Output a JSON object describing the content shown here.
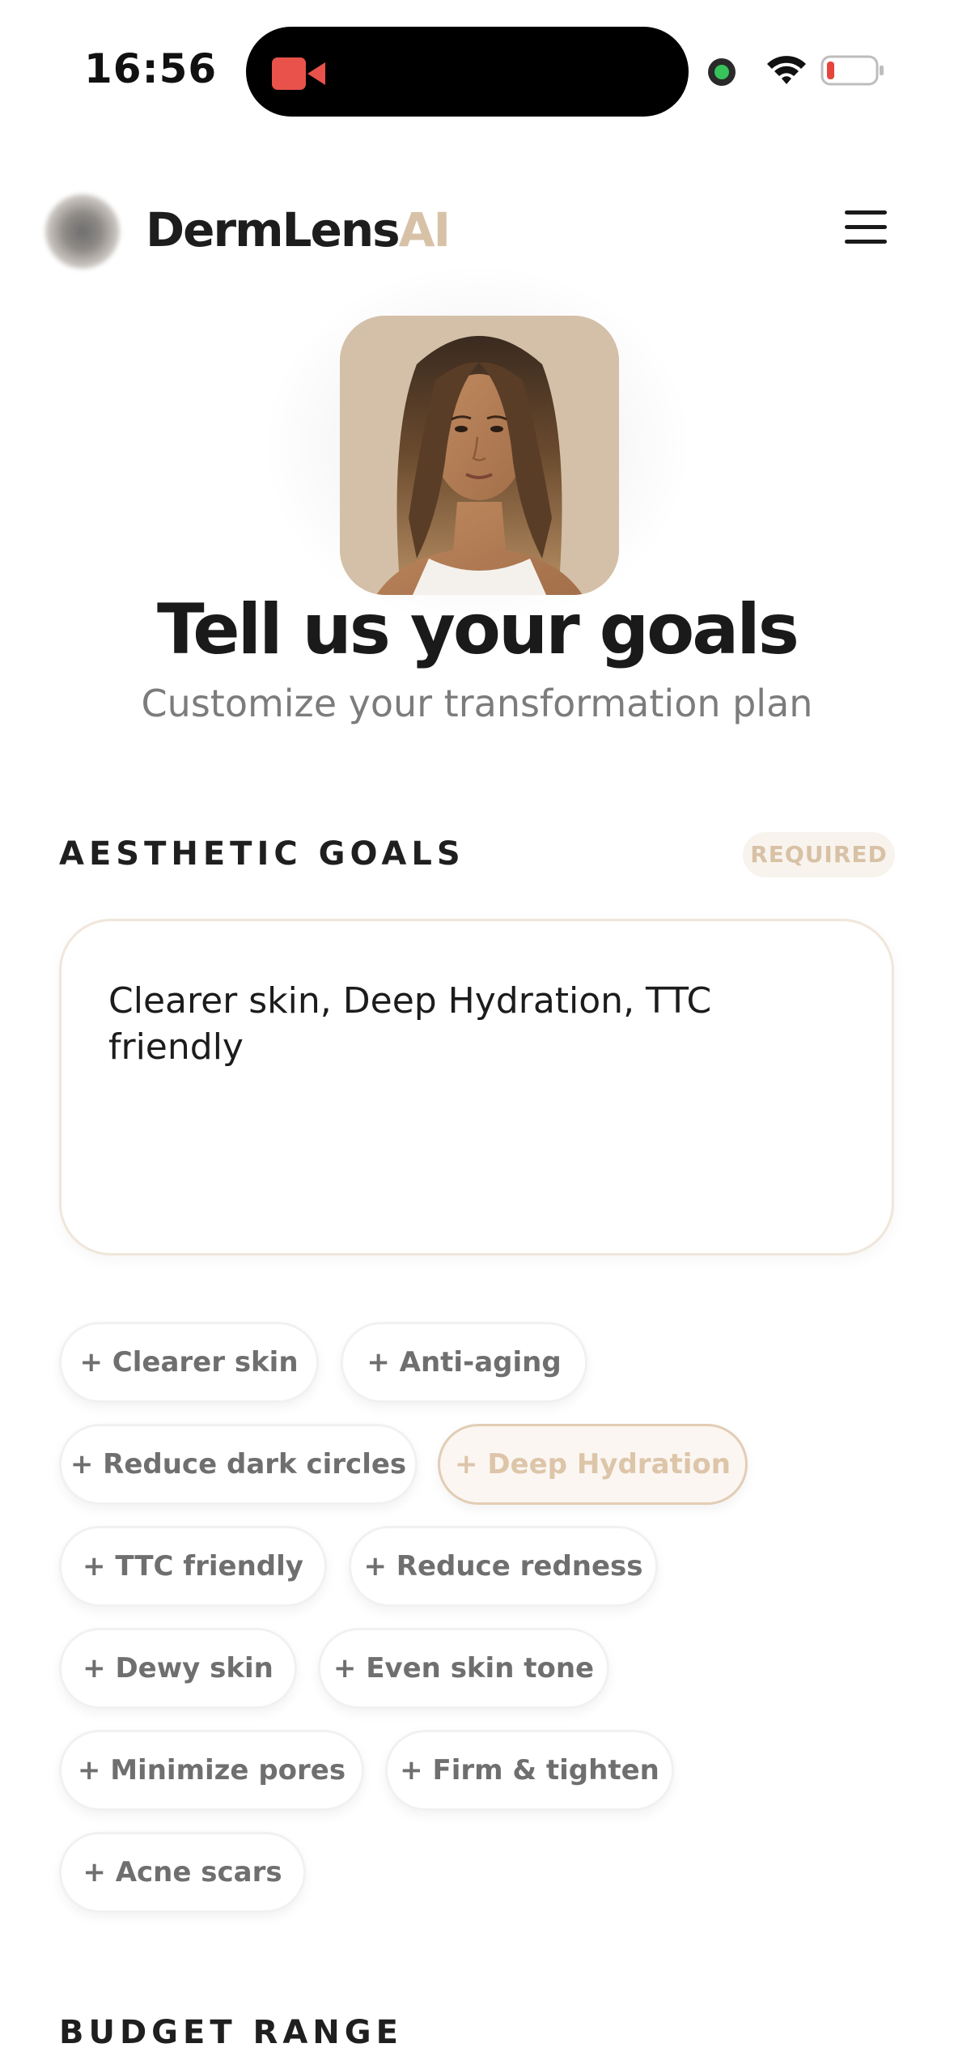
{
  "status_bar": {
    "time": "16:56"
  },
  "header": {
    "brand_main": "DermLens",
    "brand_accent": "AI",
    "accent_color": "#d8c2a7"
  },
  "hero": {
    "title": "Tell us your goals",
    "subtitle": "Customize your transformation plan"
  },
  "aesthetic_goals": {
    "label": "AESTHETIC GOALS",
    "badge": "REQUIRED",
    "input_value": "Clearer skin, Deep Hydration, TTC friendly",
    "chips": [
      {
        "label": "+ Clearer skin",
        "selected": false
      },
      {
        "label": "+ Anti-aging",
        "selected": false
      },
      {
        "label": "+ Reduce dark circles",
        "selected": false
      },
      {
        "label": "+ Deep Hydration",
        "selected": true
      },
      {
        "label": "+ TTC friendly",
        "selected": false
      },
      {
        "label": "+ Reduce redness",
        "selected": false
      },
      {
        "label": "+ Dewy skin",
        "selected": false
      },
      {
        "label": "+ Even skin tone",
        "selected": false
      },
      {
        "label": "+ Minimize pores",
        "selected": false
      },
      {
        "label": "+ Firm & tighten",
        "selected": false
      },
      {
        "label": "+ Acne scars",
        "selected": false
      }
    ]
  },
  "budget_range": {
    "label": "BUDGET RANGE"
  },
  "icons": [
    "facetime-camera-icon",
    "privacy-indicator-dot",
    "wifi-icon",
    "battery-low-icon",
    "logo-mark",
    "hamburger-menu-icon"
  ],
  "colors": {
    "chip_selected_border": "#e2cdb5",
    "chip_selected_text": "#ddc5a9",
    "camera_indicator": "#e8524a",
    "privacy_dot": "#36c35a",
    "battery_low": "#e5453c"
  }
}
